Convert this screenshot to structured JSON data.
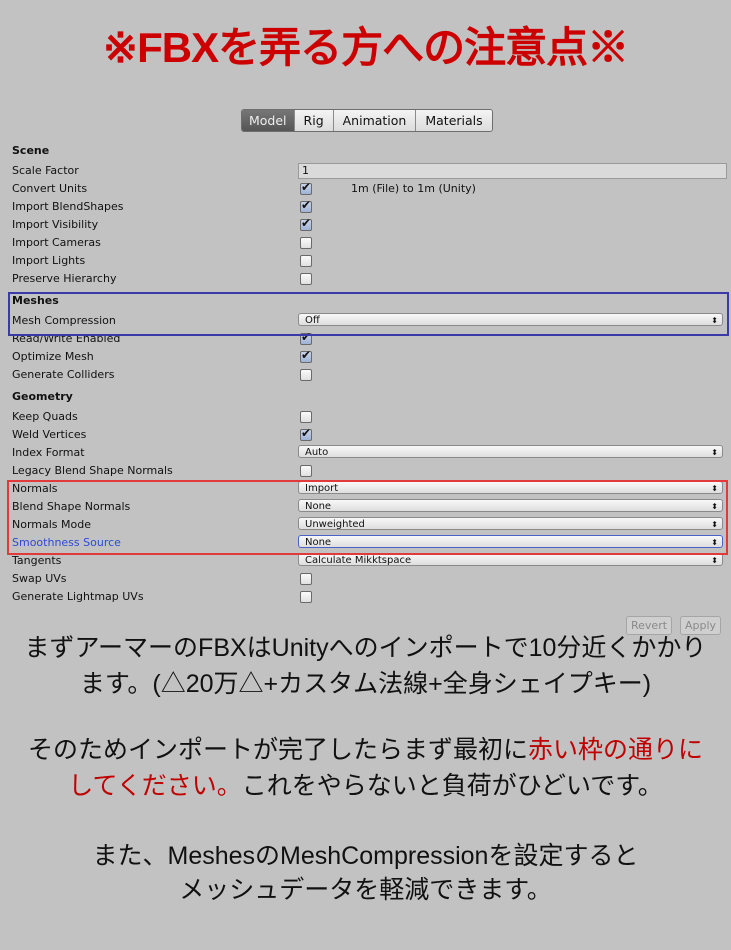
{
  "title": "※FBXを弄る方への注意点※",
  "tabs": [
    "Model",
    "Rig",
    "Animation",
    "Materials"
  ],
  "active_tab": "Model",
  "rows": [
    {
      "type": "header",
      "label": "Scene"
    },
    {
      "type": "text",
      "label": "Scale Factor",
      "value": "1"
    },
    {
      "type": "check",
      "label": "Convert Units",
      "checked": true,
      "note": "1m (File) to 1m (Unity)"
    },
    {
      "type": "check",
      "label": "Import BlendShapes",
      "checked": true
    },
    {
      "type": "check",
      "label": "Import Visibility",
      "checked": true
    },
    {
      "type": "check",
      "label": "Import Cameras",
      "checked": false
    },
    {
      "type": "check",
      "label": "Import Lights",
      "checked": false
    },
    {
      "type": "check",
      "label": "Preserve Hierarchy",
      "checked": false
    },
    {
      "type": "header",
      "label": "Meshes"
    },
    {
      "type": "dropdown",
      "label": "Mesh Compression",
      "value": "Off"
    },
    {
      "type": "check",
      "label": "Read/Write Enabled",
      "checked": true
    },
    {
      "type": "check",
      "label": "Optimize Mesh",
      "checked": true
    },
    {
      "type": "check",
      "label": "Generate Colliders",
      "checked": false
    },
    {
      "type": "header",
      "label": "Geometry"
    },
    {
      "type": "check",
      "label": "Keep Quads",
      "checked": false
    },
    {
      "type": "check",
      "label": "Weld Vertices",
      "checked": true
    },
    {
      "type": "dropdown",
      "label": "Index Format",
      "value": "Auto"
    },
    {
      "type": "check",
      "label": "Legacy Blend Shape Normals",
      "checked": false
    },
    {
      "type": "dropdown",
      "label": "Normals",
      "value": "Import"
    },
    {
      "type": "dropdown",
      "label": "Blend Shape Normals",
      "value": "None"
    },
    {
      "type": "dropdown",
      "label": "Normals Mode",
      "value": "Unweighted"
    },
    {
      "type": "dropdown",
      "label": "Smoothness Source",
      "value": "None",
      "focused": true
    },
    {
      "type": "dropdown",
      "label": "Tangents",
      "value": "Calculate Mikktspace"
    },
    {
      "type": "check",
      "label": "Swap UVs",
      "checked": false
    },
    {
      "type": "check",
      "label": "Generate Lightmap UVs",
      "checked": false
    }
  ],
  "buttons": {
    "revert": "Revert",
    "apply": "Apply"
  },
  "notes": {
    "p1_line1": "まずアーマーのFBXはUnityへのインポートで10分近くかかり",
    "p1_line2": "ます。(△20万△+カスタム法線+全身シェイプキー)",
    "p2_line1_a": "そのためインポートが完了したらまず最初に",
    "p2_line1_red": "赤い枠の通りに",
    "p2_line2_red": "してください。",
    "p2_line2_b": "これをやらないと負荷がひどいです。",
    "p3_line1": "また、MeshesのMeshCompressionを設定すると",
    "p3_line2": "メッシュデータを軽減できます。"
  },
  "colors": {
    "title": "#cc0000",
    "highlight_red": "#e23a3a",
    "highlight_blue": "#3a3aa8"
  }
}
